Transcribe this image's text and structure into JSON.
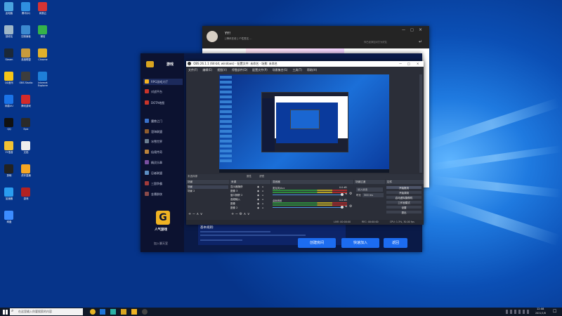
{
  "desktop": {
    "icons": [
      {
        "label": "此电脑",
        "color": "#4aa3df"
      },
      {
        "label": "腾讯QQ",
        "color": "#2f8fe0"
      },
      {
        "label": "网易云",
        "color": "#d53434"
      },
      {
        "label": "回收站",
        "color": "#9fb7c8"
      },
      {
        "label": "控制面板",
        "color": "#3c89d0"
      },
      {
        "label": "微信",
        "color": "#35b34a"
      },
      {
        "label": "Steam",
        "color": "#1b2838"
      },
      {
        "label": "英雄联盟",
        "color": "#c89b3c"
      },
      {
        "label": "Chrome",
        "color": "#e1b12c"
      },
      {
        "label": "QQ音乐",
        "color": "#f5c518"
      },
      {
        "label": "OBS Studio",
        "color": "#3d3d3d"
      },
      {
        "label": "Internet Explorer",
        "color": "#1e7fd8"
      },
      {
        "label": "网易UU",
        "color": "#1a73e8"
      },
      {
        "label": "腾讯游戏",
        "color": "#d32a2a"
      },
      {
        "label": "WeGame",
        "color": "#f0b020"
      },
      {
        "label": "QQ",
        "color": "#111"
      },
      {
        "label": "Epic",
        "color": "#2a2a2a"
      },
      {
        "label": "迅雷",
        "color": "#2b7be6"
      },
      {
        "label": "YY语音",
        "color": "#f2c233"
      },
      {
        "label": "文档",
        "color": "#eeeeee"
      },
      {
        "label": "新建文件",
        "color": "#e6e6e6"
      },
      {
        "label": "剪映",
        "color": "#222"
      },
      {
        "label": "虎牙直播",
        "color": "#f6a623"
      },
      {
        "label": "斗鱼",
        "color": "#ff7d00"
      },
      {
        "label": "加速器",
        "color": "#2a9cf0"
      },
      {
        "label": "游戏",
        "color": "#b22222"
      },
      {
        "label": "设置",
        "color": "#2b6fd6"
      },
      {
        "label": "网盘",
        "color": "#3c8cff"
      }
    ]
  },
  "chat": {
    "name": "YY!",
    "status": "[ 腾讯在线 ] 个性签名 ...",
    "note": "你已经添加对方为好友"
  },
  "game": {
    "logo": "游戏",
    "sidebar": [
      {
        "label": "RPG游戏大厅",
        "color": "#f5b321"
      },
      {
        "label": "对战平台",
        "color": "#c9342a"
      },
      {
        "label": "DOTA地图",
        "color": "#c9342a"
      },
      {
        "label": "魔兽之门",
        "color": "#3a71c9"
      },
      {
        "label": "澄海联盟",
        "color": "#8f5d2e"
      },
      {
        "label": "冰雪世界",
        "color": "#6b7f91"
      },
      {
        "label": "仙境传奇",
        "color": "#b9823b"
      },
      {
        "label": "精灵乐章",
        "color": "#7a4fa0"
      },
      {
        "label": "忍者联盟",
        "color": "#5d8fc4"
      },
      {
        "label": "三国争霸",
        "color": "#a23a3a"
      },
      {
        "label": "金庸群侠",
        "color": "#8a4a4a"
      }
    ],
    "brand": "人气游戏",
    "bottom_link": "加入聊天室",
    "announce_title": "基本规则:",
    "buttons": {
      "create": "创建房间",
      "quick": "快速加入",
      "back": "返回"
    }
  },
  "obs": {
    "title": "OBS 26.1.1 (64-bit, windows) - 配置文件: 未命名 - 场景: 未命名",
    "menu": [
      "文件(F)",
      "编辑(E)",
      "视图(V)",
      "停靠部件(D)",
      "配置文件(P)",
      "场景集合(S)",
      "工具(T)",
      "帮助(H)"
    ],
    "scenes_label": "场景",
    "sources_label": "来源",
    "mixer_label": "混音器",
    "transitions_label": "场景过渡",
    "controls_label": "控件",
    "no_source": "未选择源",
    "properties": "属性",
    "filters": "滤镜",
    "scenes": [
      "场景",
      "场景 2"
    ],
    "sources": [
      "显示器捕获",
      "图像 3",
      "窗口捕获 2",
      "音频输入",
      "图像",
      "图像 2"
    ],
    "audio": [
      {
        "name": "麦克风/Aux",
        "level": "0.0 dB"
      },
      {
        "name": "桌面音频",
        "level": "0.0 dB"
      }
    ],
    "transition": {
      "type": "淡入淡出",
      "duration_label": "时长",
      "duration": "300 ms"
    },
    "controls": [
      "开始推流",
      "开始录制",
      "启动虚拟摄像机",
      "工作室模式",
      "设置",
      "退出"
    ],
    "status": {
      "live": "LIVE: 00:00:00",
      "rec": "REC: 00:00:00",
      "cpu": "CPU: 1.3%, 30.00 fps"
    }
  },
  "taskbar": {
    "search_placeholder": "在这里输入你要搜索的内容",
    "time": "12:08",
    "date": "2021/1/8"
  }
}
